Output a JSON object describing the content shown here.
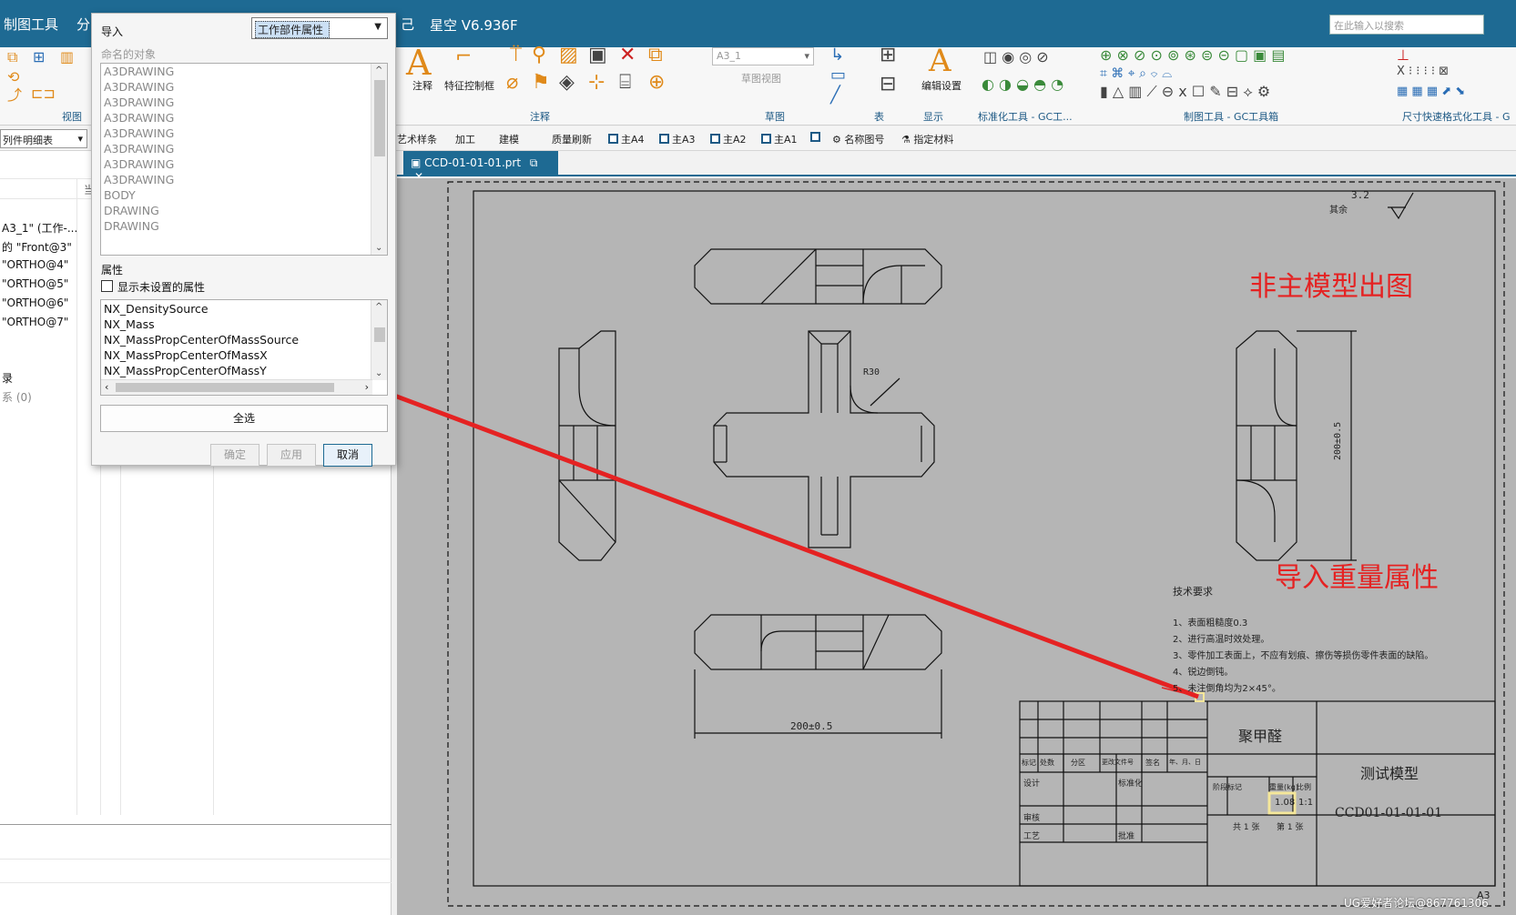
{
  "titlebar": {
    "menu_drafting": "制图工具",
    "menu_fen": "分",
    "menu_fragment": "己",
    "app_title": "星空 V6.936F",
    "search_placeholder": "在此输入以搜索"
  },
  "ribbon": {
    "group_view": "视图",
    "annotation_label": "注释",
    "feature_control_label": "特征控制框",
    "group_annotation": "注释",
    "sheet_dropdown": "A3_1",
    "sketch_view_label": "草图视图",
    "group_sketch": "草图",
    "group_table": "表",
    "edit_settings_label": "编辑设置",
    "group_display": "显示",
    "group_std_tools": "标准化工具 - GC工...",
    "group_drafting_tools": "制图工具 - GC工具箱",
    "group_dim_tools": "尺寸快速格式化工具 - G"
  },
  "quickbar": {
    "parts_list_select": "列件明细表",
    "items": [
      "艺术样条",
      "加工",
      "建模",
      "质量刷新",
      "主A4",
      "主A3",
      "主A2",
      "主A1",
      "",
      "名称图号",
      "指定材料"
    ]
  },
  "navigator": {
    "col_fragment": "当",
    "rows": [
      "A3_1\" (工作-...",
      "的 \"Front@3\"",
      "\"ORTHO@4\"",
      "\"ORTHO@5\"",
      "\"ORTHO@6\"",
      "\"ORTHO@7\"",
      "录",
      "系 (0)"
    ]
  },
  "doc_tab": {
    "label": "CCD-01-01-01.prt"
  },
  "dialog": {
    "title": "导入",
    "source_select": "工作部件属性",
    "named_objects_label": "命名的对象",
    "named_objects": [
      "A3DRAWING",
      "A3DRAWING",
      "A3DRAWING",
      "A3DRAWING",
      "A3DRAWING",
      "A3DRAWING",
      "A3DRAWING",
      "A3DRAWING",
      "BODY",
      "DRAWING",
      "DRAWING"
    ],
    "attributes_label": "属性",
    "show_unset_label": "显示未设置的属性",
    "show_unset_checked": false,
    "attributes": [
      "NX_DensitySource",
      "NX_Mass",
      "NX_MassPropCenterOfMassSource",
      "NX_MassPropCenterOfMassX",
      "NX_MassPropCenterOfMassY"
    ],
    "select_all": "全选",
    "ok": "确定",
    "apply": "应用",
    "cancel": "取消"
  },
  "drawing": {
    "annotation_top": "非主模型出图",
    "annotation_bottom": "导入重量属性",
    "roughness_value": "3.2",
    "roughness_label": "其余",
    "radius_label": "R30",
    "dim_vertical": "200±0.5",
    "dim_horizontal": "200±0.5",
    "tech_title": "技术要求",
    "tech_notes": [
      "1、表面粗糙度0.3",
      "2、进行高温时效处理。",
      "3、零件加工表面上，不应有划痕、擦伤等损伤零件表面的缺陷。",
      "4、锐边倒钝。",
      "5、未注倒角均为2×45°。"
    ],
    "title_block": {
      "material": "聚甲醛",
      "part_name": "测试模型",
      "drawing_no": "CCD01-01-01-01",
      "mass": "1.08",
      "scale": "1:1",
      "weight_header": "重量(kg)",
      "scale_header": "比例",
      "stage_header": "阶段标记",
      "sheet_total": "共 1 张",
      "sheet_no": "第 1 张",
      "row_labels": [
        "标记",
        "处数",
        "分区",
        "更改文件号",
        "签名",
        "年、月、日"
      ],
      "left_labels": [
        "设计",
        "标准化",
        "审核",
        "工艺",
        "批准"
      ],
      "sheet_size": "A3"
    },
    "watermark": "UG爱好者论坛@867761306"
  },
  "colors": {
    "titlebar": "#1e6a93",
    "annotation": "#e52222",
    "drawing_bg": "#b5b5b5",
    "highlight_box": "#f5e79a"
  }
}
